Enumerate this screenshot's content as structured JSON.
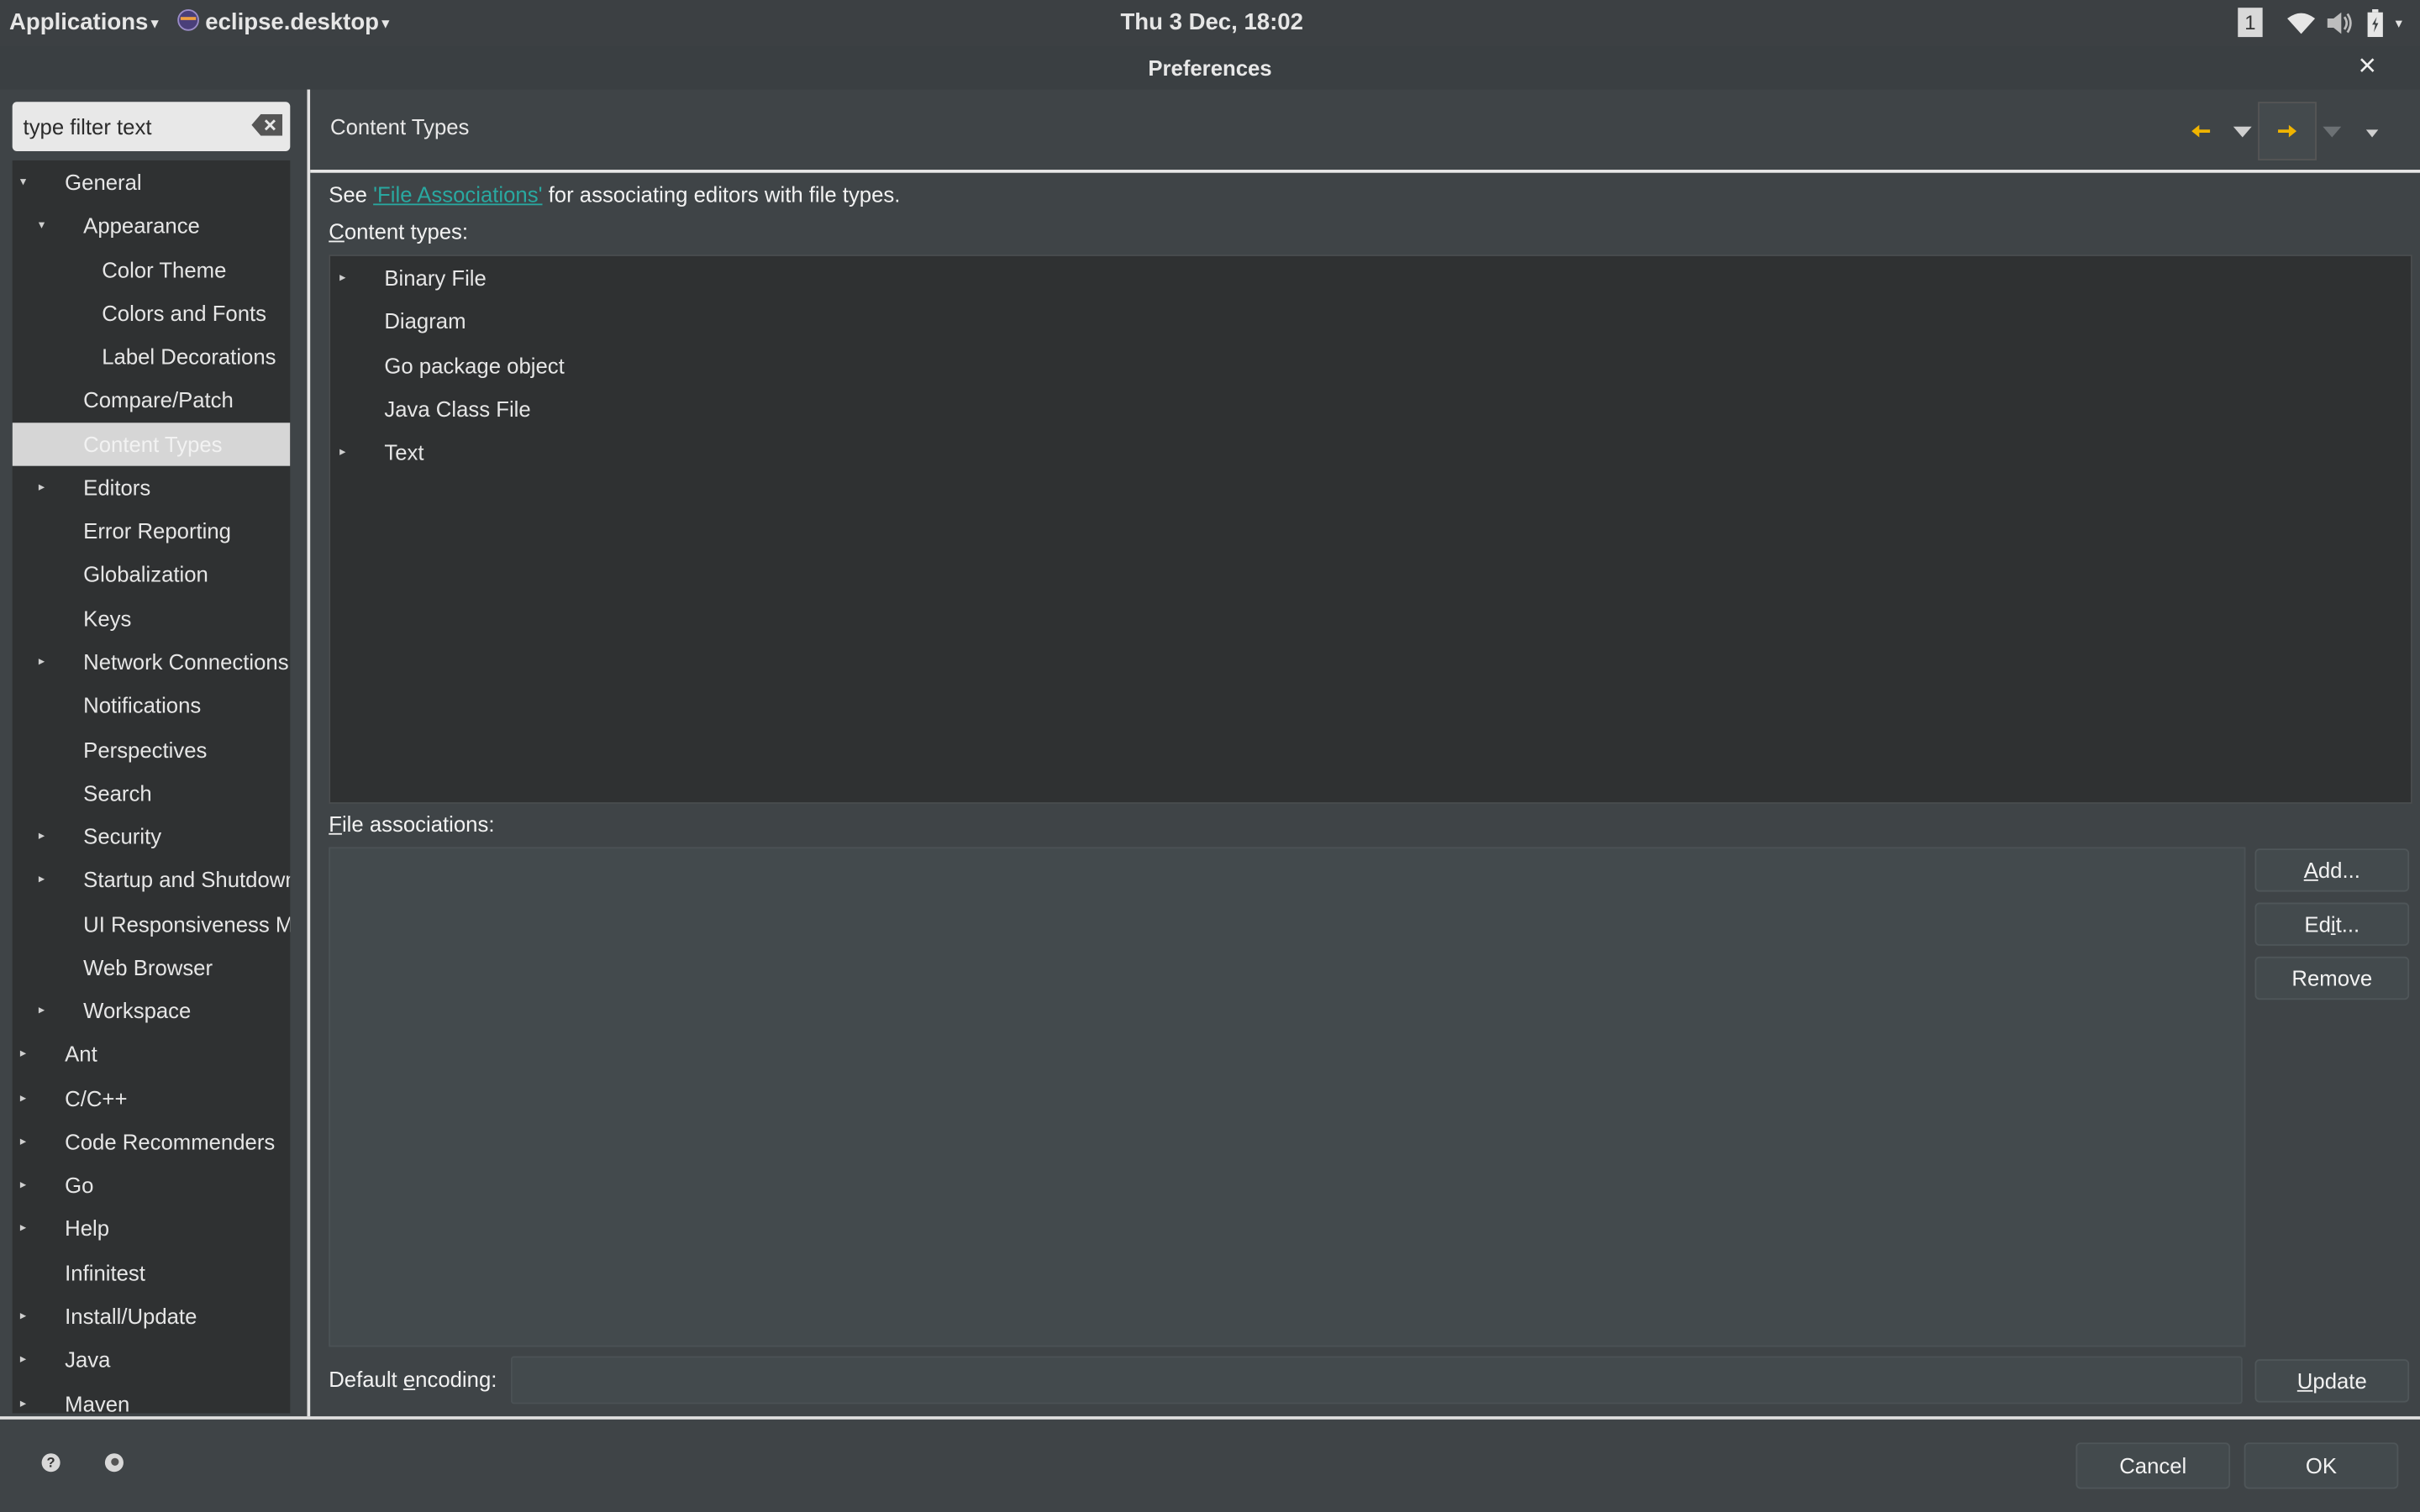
{
  "topbar": {
    "applications_label": "Applications",
    "app_name": "eclipse.desktop",
    "clock": "Thu  3 Dec, 18:02",
    "workspace_number": "1"
  },
  "window": {
    "title": "Preferences",
    "close_icon": "close-icon"
  },
  "nav": {
    "filter_placeholder": "type filter text",
    "tree": [
      {
        "label": "General",
        "level": 0,
        "expander": "expanded"
      },
      {
        "label": "Appearance",
        "level": 1,
        "expander": "expanded"
      },
      {
        "label": "Color Theme",
        "level": 2,
        "expander": "none"
      },
      {
        "label": "Colors and Fonts",
        "level": 2,
        "expander": "none"
      },
      {
        "label": "Label Decorations",
        "level": 2,
        "expander": "none"
      },
      {
        "label": "Compare/Patch",
        "level": 1,
        "expander": "none"
      },
      {
        "label": "Content Types",
        "level": 1,
        "expander": "none",
        "selected": true
      },
      {
        "label": "Editors",
        "level": 1,
        "expander": "collapsed"
      },
      {
        "label": "Error Reporting",
        "level": 1,
        "expander": "none"
      },
      {
        "label": "Globalization",
        "level": 1,
        "expander": "none"
      },
      {
        "label": "Keys",
        "level": 1,
        "expander": "none"
      },
      {
        "label": "Network Connections",
        "level": 1,
        "expander": "collapsed"
      },
      {
        "label": "Notifications",
        "level": 1,
        "expander": "none"
      },
      {
        "label": "Perspectives",
        "level": 1,
        "expander": "none"
      },
      {
        "label": "Search",
        "level": 1,
        "expander": "none"
      },
      {
        "label": "Security",
        "level": 1,
        "expander": "collapsed"
      },
      {
        "label": "Startup and Shutdown",
        "level": 1,
        "expander": "collapsed"
      },
      {
        "label": "UI Responsiveness Monitoring",
        "level": 1,
        "expander": "none"
      },
      {
        "label": "Web Browser",
        "level": 1,
        "expander": "none"
      },
      {
        "label": "Workspace",
        "level": 1,
        "expander": "collapsed"
      },
      {
        "label": "Ant",
        "level": 0,
        "expander": "collapsed"
      },
      {
        "label": "C/C++",
        "level": 0,
        "expander": "collapsed"
      },
      {
        "label": "Code Recommenders",
        "level": 0,
        "expander": "collapsed"
      },
      {
        "label": "Go",
        "level": 0,
        "expander": "collapsed"
      },
      {
        "label": "Help",
        "level": 0,
        "expander": "collapsed"
      },
      {
        "label": "Infinitest",
        "level": 0,
        "expander": "none"
      },
      {
        "label": "Install/Update",
        "level": 0,
        "expander": "collapsed"
      },
      {
        "label": "Java",
        "level": 0,
        "expander": "collapsed"
      },
      {
        "label": "Maven",
        "level": 0,
        "expander": "collapsed"
      }
    ]
  },
  "page": {
    "title": "Content Types",
    "see_prefix": "See ",
    "see_link": "'File Associations'",
    "see_suffix": " for associating editors with file types.",
    "content_types_label_first": "C",
    "content_types_label_rest": "ontent types:",
    "content_types": [
      {
        "label": "Binary File",
        "expandable": true
      },
      {
        "label": "Diagram",
        "expandable": false
      },
      {
        "label": "Go package object",
        "expandable": false
      },
      {
        "label": "Java Class File",
        "expandable": false
      },
      {
        "label": "Text",
        "expandable": true
      }
    ],
    "file_assoc_label_first": "F",
    "file_assoc_label_rest": "ile associations:",
    "add_first": "A",
    "add_rest": "dd...",
    "edit_first": "Ed",
    "edit_u": "i",
    "edit_rest": "t...",
    "remove_label": "Remove",
    "encoding_prefix": "Default ",
    "encoding_u": "e",
    "encoding_rest": "ncoding:",
    "encoding_value": "",
    "update_u": "U",
    "update_rest": "pdate"
  },
  "footer": {
    "cancel_label": "Cancel",
    "ok_label": "OK"
  },
  "colors": {
    "link": "#29a8a0",
    "selection": "#d6d6d6",
    "accent_arrow": "#f0b400"
  }
}
